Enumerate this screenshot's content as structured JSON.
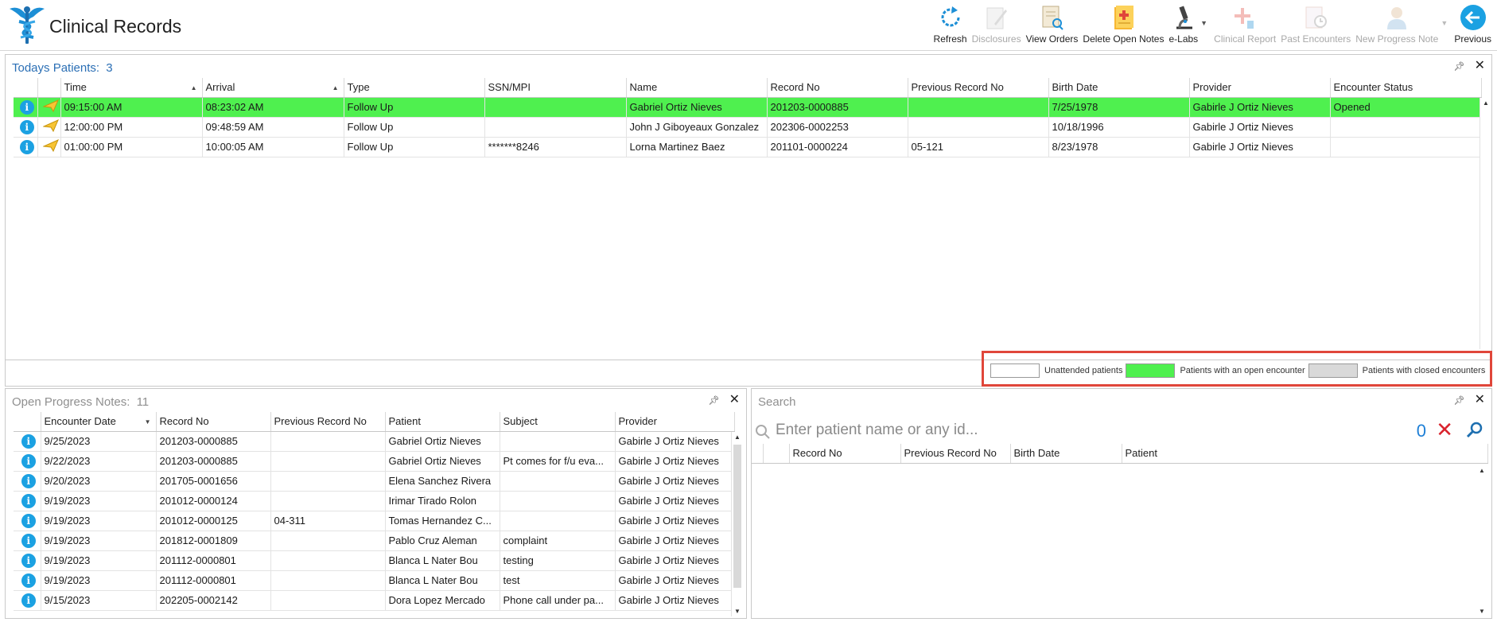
{
  "app": {
    "title": "Clinical Records"
  },
  "toolbar": {
    "refresh": "Refresh",
    "disclosures": "Disclosures",
    "view_orders": "View Orders",
    "delete_open_notes": "Delete Open Notes",
    "elabs": "e-Labs",
    "clinical_report": "Clinical Report",
    "past_encounters": "Past Encounters",
    "new_progress_note": "New Progress Note",
    "previous": "Previous"
  },
  "todays": {
    "title": "Todays Patients:",
    "count": "3",
    "columns": [
      "Time",
      "Arrival",
      "Type",
      "SSN/MPI",
      "Name",
      "Record No",
      "Previous Record No",
      "Birth Date",
      "Provider",
      "Encounter Status"
    ],
    "rows": [
      {
        "time": "09:15:00 AM",
        "arrival": "08:23:02 AM",
        "type": "Follow Up",
        "ssn": "",
        "name": "Gabriel Ortiz Nieves",
        "record": "201203-0000885",
        "prev": "",
        "birth": "7/25/1978",
        "provider": "Gabirle J Ortiz Nieves",
        "status": "Opened"
      },
      {
        "time": "12:00:00 PM",
        "arrival": "09:48:59 AM",
        "type": "Follow Up",
        "ssn": "",
        "name": "John J Giboyeaux Gonzalez",
        "record": "202306-0002253",
        "prev": "",
        "birth": "10/18/1996",
        "provider": "Gabirle J Ortiz Nieves",
        "status": ""
      },
      {
        "time": "01:00:00 PM",
        "arrival": "10:00:05 AM",
        "type": "Follow Up",
        "ssn": "*******8246",
        "name": "Lorna Martinez Baez",
        "record": "201101-0000224",
        "prev": "05-121",
        "birth": "8/23/1978",
        "provider": "Gabirle J Ortiz Nieves",
        "status": ""
      }
    ]
  },
  "legend": {
    "unattended": "Unattended patients",
    "open": "Patients with an open encounter",
    "closed": "Patients with closed encounters",
    "unattended_color": "#ffffff",
    "open_color": "#4ff04f",
    "closed_color": "#d9d9d9"
  },
  "notes": {
    "title": "Open Progress Notes:",
    "count": "11",
    "columns": [
      "Encounter Date",
      "Record No",
      "Previous Record No",
      "Patient",
      "Subject",
      "Provider"
    ],
    "rows": [
      {
        "date": "9/25/2023",
        "record": "201203-0000885",
        "prev": "",
        "patient": "Gabriel Ortiz Nieves",
        "subject": "",
        "provider": "Gabirle J Ortiz Nieves"
      },
      {
        "date": "9/22/2023",
        "record": "201203-0000885",
        "prev": "",
        "patient": "Gabriel Ortiz Nieves",
        "subject": "Pt comes for f/u eva...",
        "provider": "Gabirle J Ortiz Nieves"
      },
      {
        "date": "9/20/2023",
        "record": "201705-0001656",
        "prev": "",
        "patient": "Elena Sanchez Rivera",
        "subject": "",
        "provider": "Gabirle J Ortiz Nieves"
      },
      {
        "date": "9/19/2023",
        "record": "201012-0000124",
        "prev": "",
        "patient": "Irimar Tirado Rolon",
        "subject": "",
        "provider": "Gabirle J Ortiz Nieves"
      },
      {
        "date": "9/19/2023",
        "record": "201012-0000125",
        "prev": "04-311",
        "patient": "Tomas Hernandez C...",
        "subject": "",
        "provider": "Gabirle J Ortiz Nieves"
      },
      {
        "date": "9/19/2023",
        "record": "201812-0001809",
        "prev": "",
        "patient": "Pablo Cruz Aleman",
        "subject": "complaint",
        "provider": "Gabirle J Ortiz Nieves"
      },
      {
        "date": "9/19/2023",
        "record": "201112-0000801",
        "prev": "",
        "patient": "Blanca L Nater Bou",
        "subject": "testing",
        "provider": "Gabirle J Ortiz Nieves"
      },
      {
        "date": "9/19/2023",
        "record": "201112-0000801",
        "prev": "",
        "patient": "Blanca L Nater Bou",
        "subject": "test",
        "provider": "Gabirle J Ortiz Nieves"
      },
      {
        "date": "9/15/2023",
        "record": "202205-0002142",
        "prev": "",
        "patient": "Dora Lopez Mercado",
        "subject": "Phone call under pa...",
        "provider": "Gabirle J Ortiz Nieves"
      }
    ]
  },
  "search": {
    "title": "Search",
    "placeholder": "Enter patient name or any id...",
    "count": "0",
    "columns": [
      "Record No",
      "Previous Record No",
      "Birth Date",
      "Patient"
    ]
  },
  "icons": {
    "row_info": "info-icon",
    "row_flag": "paper-plane-icon"
  }
}
